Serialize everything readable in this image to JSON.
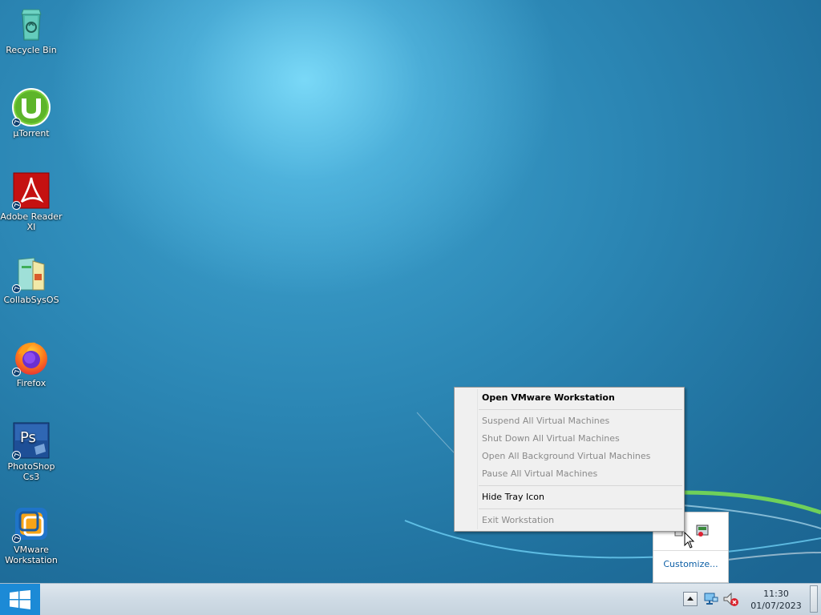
{
  "desktop": {
    "icons": [
      {
        "label": "Recycle Bin",
        "icon": "recycle-bin-icon",
        "shortcut": false
      },
      {
        "label": "µTorrent",
        "icon": "utorrent-icon",
        "shortcut": true
      },
      {
        "label": "Adobe Reader XI",
        "icon": "adobe-reader-icon",
        "shortcut": true
      },
      {
        "label": "CollabSysOS",
        "icon": "collabsysos-icon",
        "shortcut": true
      },
      {
        "label": "Firefox",
        "icon": "firefox-icon",
        "shortcut": true
      },
      {
        "label": "PhotoShop Cs3",
        "icon": "photoshop-icon",
        "shortcut": true
      },
      {
        "label": "VMware Workstation",
        "icon": "vmware-workstation-icon",
        "shortcut": true
      }
    ]
  },
  "context_menu": {
    "items": [
      {
        "label": "Open VMware Workstation",
        "enabled": true,
        "default": true
      },
      {
        "label": "Suspend All Virtual Machines",
        "enabled": false
      },
      {
        "label": "Shut Down All Virtual Machines",
        "enabled": false
      },
      {
        "label": "Open All Background Virtual Machines",
        "enabled": false
      },
      {
        "label": "Pause All Virtual Machines",
        "enabled": false
      },
      {
        "label": "Hide Tray Icon",
        "enabled": true
      },
      {
        "label": "Exit Workstation",
        "enabled": false
      }
    ]
  },
  "tray_popup": {
    "icons": [
      "vmware-tray-icon",
      "tray-app-icon"
    ],
    "customize_label": "Customize..."
  },
  "taskbar": {
    "start_icon": "windows-logo-icon",
    "tray_icons": [
      "show-hidden-icons-chevron",
      "network-icon",
      "volume-muted-icon"
    ],
    "clock": {
      "time": "11:30",
      "date": "01/07/2023"
    }
  },
  "colors": {
    "desktop_accent": "#2b86b4",
    "start_button": "#1c8ad6",
    "link": "#0d5fa6"
  }
}
